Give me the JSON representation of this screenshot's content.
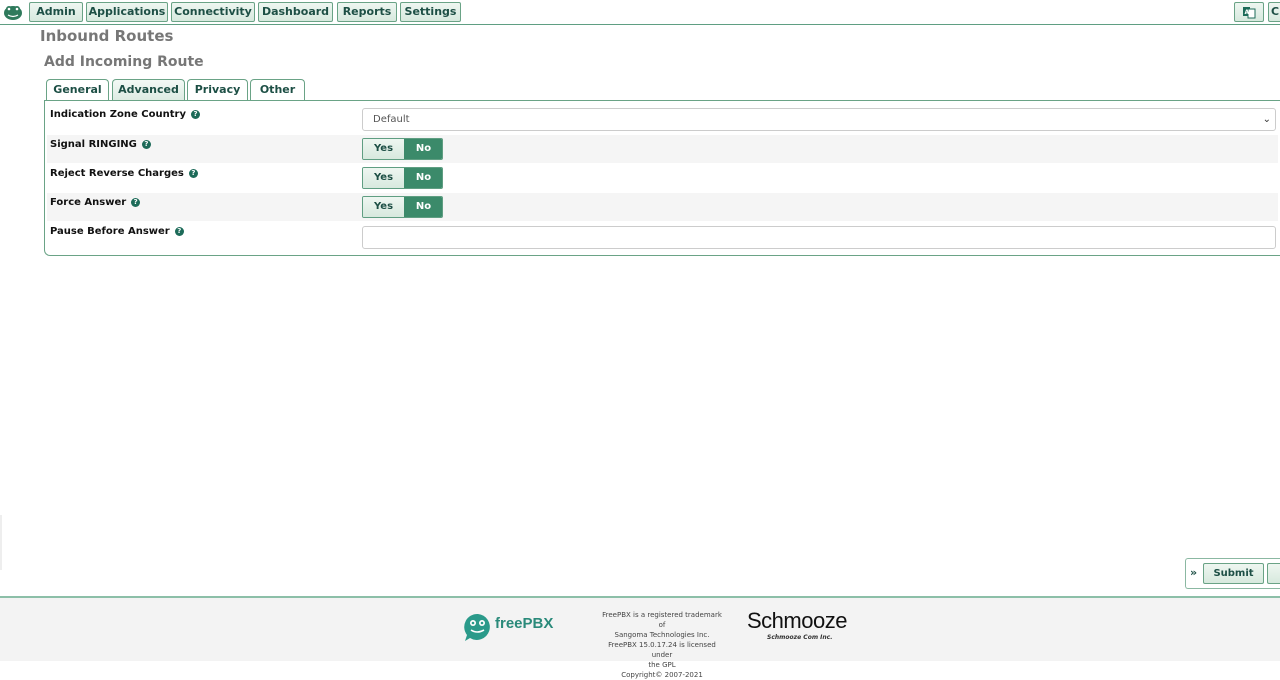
{
  "nav": {
    "items": [
      {
        "label": "Admin"
      },
      {
        "label": "Applications"
      },
      {
        "label": "Connectivity"
      },
      {
        "label": "Dashboard"
      },
      {
        "label": "Reports"
      },
      {
        "label": "Settings"
      }
    ],
    "right_icon": "language-icon",
    "right_partial_label": "C"
  },
  "page": {
    "title": "Inbound Routes",
    "subtitle": "Add Incoming Route"
  },
  "tabs": [
    {
      "label": "General",
      "active": false
    },
    {
      "label": "Advanced",
      "active": true
    },
    {
      "label": "Privacy",
      "active": false
    },
    {
      "label": "Other",
      "active": false
    }
  ],
  "form": {
    "indication_zone": {
      "label": "Indication Zone Country",
      "value": "Default"
    },
    "signal_ringing": {
      "label": "Signal RINGING",
      "yes": "Yes",
      "no": "No",
      "selected": "No"
    },
    "reject_reverse": {
      "label": "Reject Reverse Charges",
      "yes": "Yes",
      "no": "No",
      "selected": "No"
    },
    "force_answer": {
      "label": "Force Answer",
      "yes": "Yes",
      "no": "No",
      "selected": "No"
    },
    "pause_before": {
      "label": "Pause Before Answer",
      "value": ""
    }
  },
  "actions": {
    "arrow": "»",
    "submit": "Submit"
  },
  "footer": {
    "brand": "freePBX",
    "legal": [
      "FreePBX is a registered trademark of",
      "Sangoma Technologies Inc.",
      "FreePBX 15.0.17.24 is licensed under",
      "the GPL",
      "Copyright© 2007-2021"
    ],
    "company": "Schmooze",
    "company_sub": "Schmooze Com Inc."
  },
  "colors": {
    "accent": "#3b8a6a",
    "border": "#6aa386",
    "text_dark_green": "#1d4f45"
  }
}
